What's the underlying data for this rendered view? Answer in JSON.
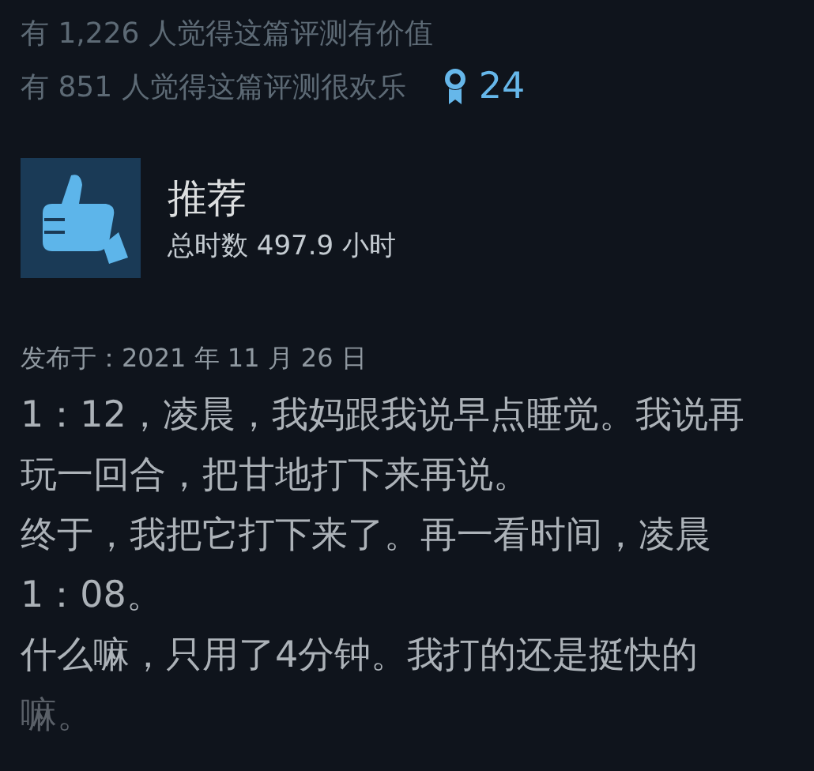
{
  "helpful": {
    "useful_text": "有 1,226 人觉得这篇评测有价值",
    "funny_text": "有 851 人觉得这篇评测很欢乐",
    "awards": "24"
  },
  "review": {
    "verdict": "推荐",
    "recommended": true,
    "playtime": "总时数 497.9 小时",
    "posted": "发布于：2021 年 11 月 26 日",
    "lines": [
      "1：12，凌晨，我妈跟我说早点睡觉。我说再",
      "玩一回合，把甘地打下来再说。",
      "终于，我把它打下来了。再一看时间，凌晨",
      "1：08。",
      "什么嘛，只用了4分钟。我打的还是挺快的",
      "嘛。"
    ],
    "fade_out": true
  }
}
